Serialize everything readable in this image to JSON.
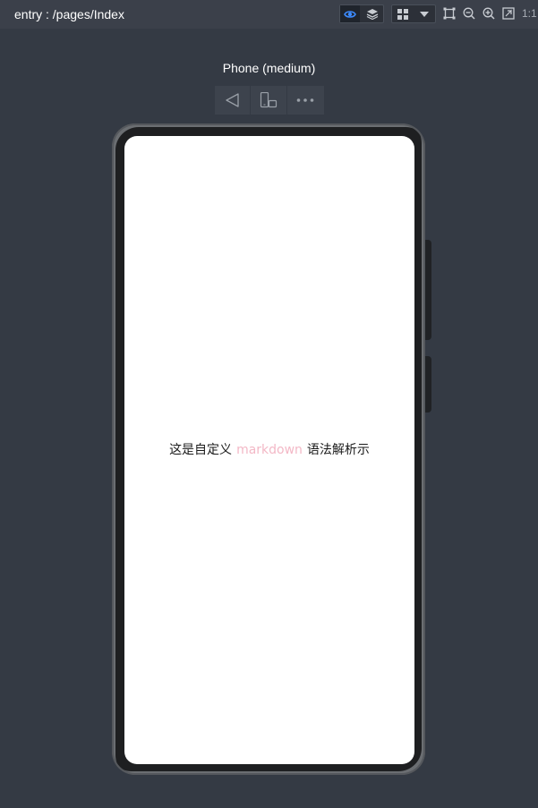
{
  "toolbar": {
    "breadcrumb": "entry : /pages/Index",
    "ratio_label": "1:1",
    "icons": [
      "eye-icon",
      "layers-icon",
      "grid-icon",
      "dropdown-icon",
      "crop-icon",
      "zoom-out-icon",
      "zoom-in-icon",
      "fit-screen-icon"
    ],
    "accent_color": "#3d8bfd"
  },
  "device": {
    "label": "Phone (medium)",
    "controls": [
      "back-icon",
      "rotate-icon",
      "more-icon"
    ]
  },
  "screen": {
    "text_before": "这是自定义",
    "text_markdown": "markdown",
    "text_after": "语法解析示",
    "markdown_color": "#f3b8c6"
  }
}
